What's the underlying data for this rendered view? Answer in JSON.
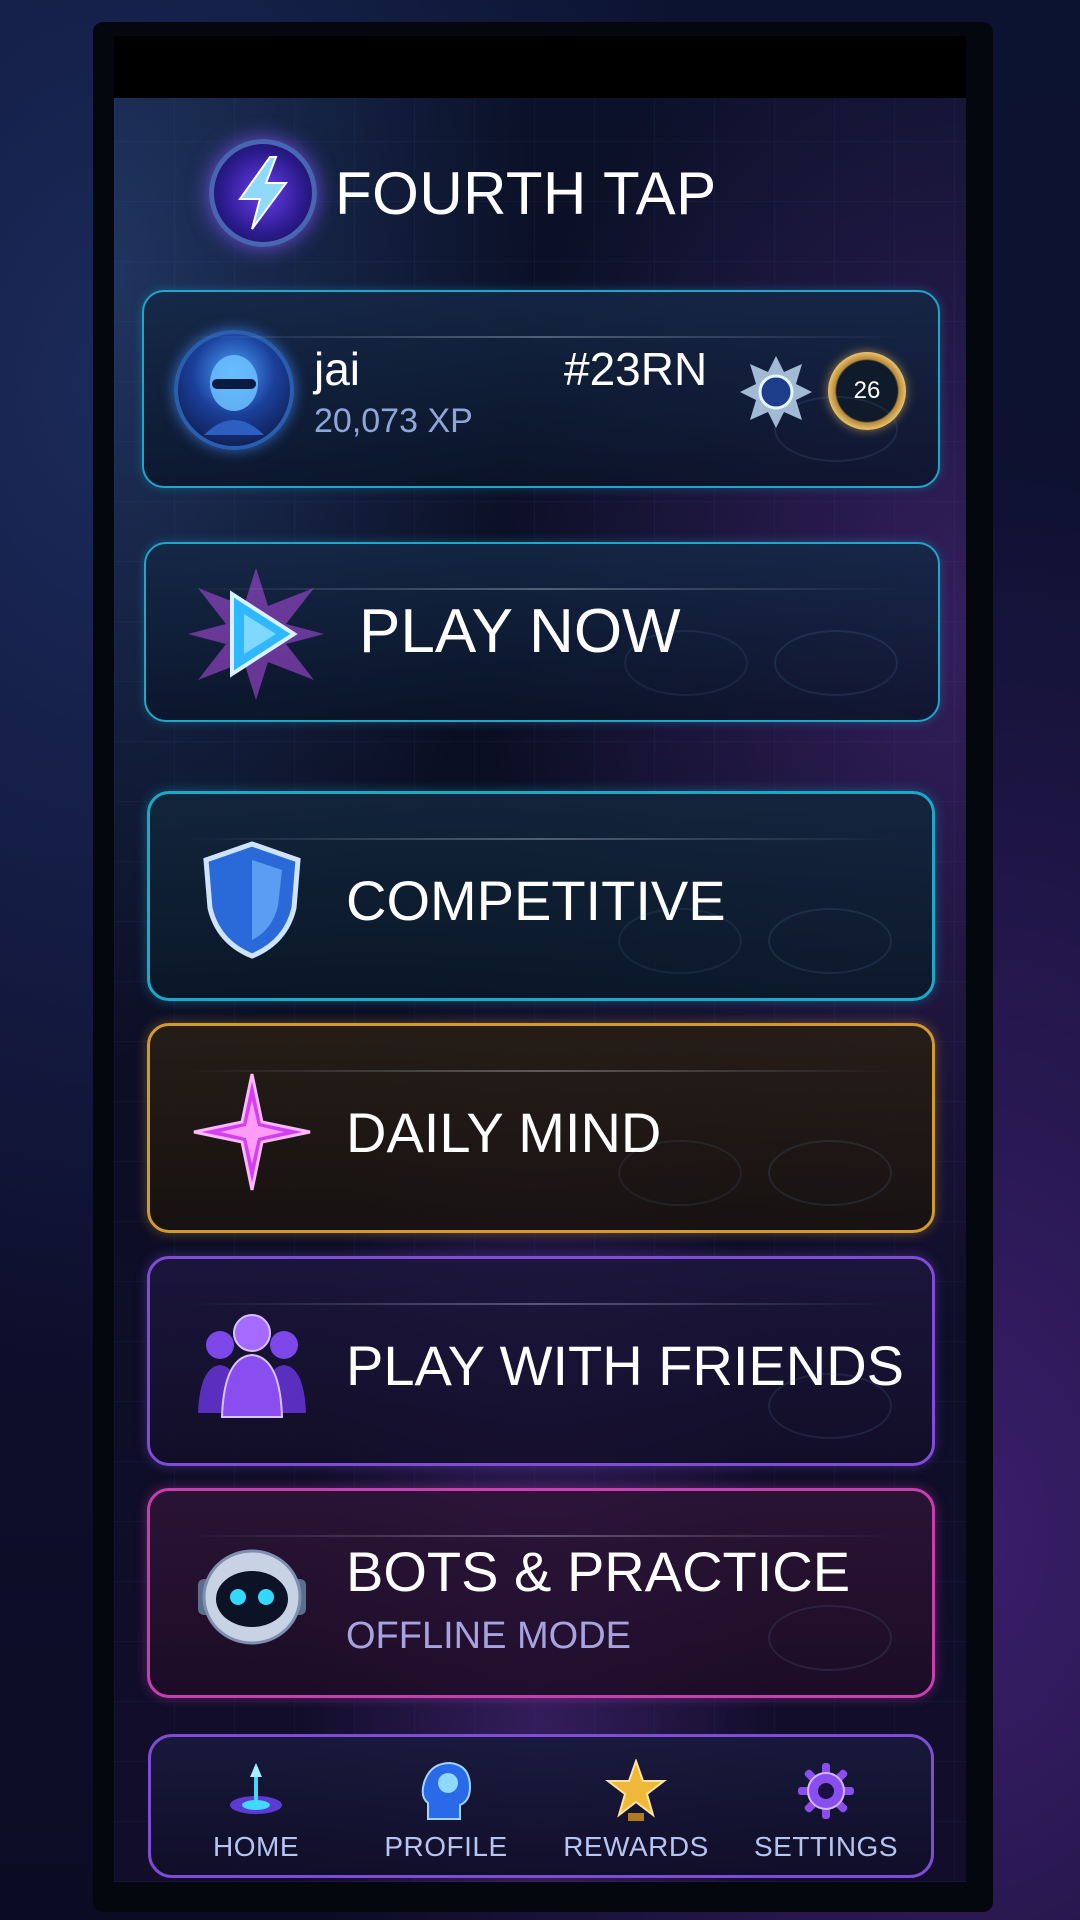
{
  "app": {
    "title": "FOURTH TAP",
    "logo_icon": "lightning-bolt-icon"
  },
  "profile": {
    "username": "jai",
    "xp": "20,073 XP",
    "player_tag": "#23RN",
    "rank_icon": "crown-emblem-icon",
    "level": "26"
  },
  "play": {
    "label": "PLAY NOW",
    "icon": "play-crystal-icon"
  },
  "modes": [
    {
      "label": "COMPETITIVE",
      "icon": "shield-icon",
      "accent": "#1aa9c8"
    },
    {
      "label": "DAILY MIND",
      "icon": "sparkle-star-icon",
      "accent": "#d19a2d"
    },
    {
      "label": "PLAY WITH FRIENDS",
      "icon": "friends-group-icon",
      "accent": "#7e4cd6"
    },
    {
      "label": "BOTS & PRACTICE",
      "sublabel": "OFFLINE MODE",
      "icon": "robot-icon",
      "accent": "#c73fae"
    }
  ],
  "nav": [
    {
      "label": "HOME",
      "icon": "home-portal-icon"
    },
    {
      "label": "PROFILE",
      "icon": "brain-head-icon"
    },
    {
      "label": "REWARDS",
      "icon": "trophy-star-icon"
    },
    {
      "label": "SETTINGS",
      "icon": "gear-icon"
    }
  ]
}
